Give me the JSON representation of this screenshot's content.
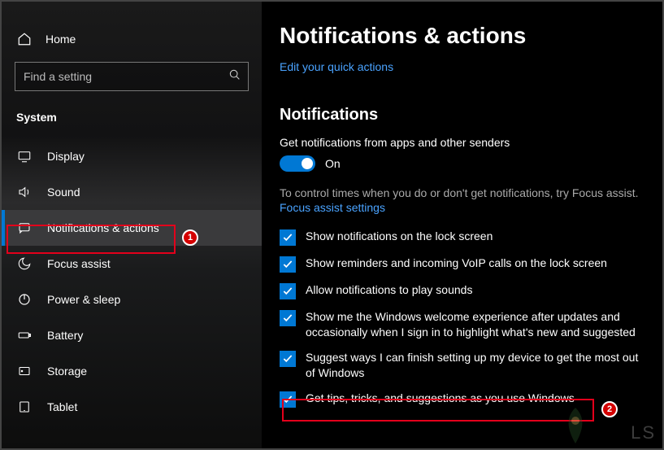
{
  "sidebar": {
    "home_label": "Home",
    "search_placeholder": "Find a setting",
    "section": "System",
    "items": [
      {
        "icon": "display",
        "label": "Display"
      },
      {
        "icon": "sound",
        "label": "Sound"
      },
      {
        "icon": "notifications",
        "label": "Notifications & actions",
        "active": true
      },
      {
        "icon": "focus",
        "label": "Focus assist"
      },
      {
        "icon": "power",
        "label": "Power & sleep"
      },
      {
        "icon": "battery",
        "label": "Battery"
      },
      {
        "icon": "storage",
        "label": "Storage"
      },
      {
        "icon": "tablet",
        "label": "Tablet"
      }
    ]
  },
  "main": {
    "title": "Notifications & actions",
    "quick_actions_link": "Edit your quick actions",
    "notifications_heading": "Notifications",
    "notif_desc": "Get notifications from apps and other senders",
    "toggle_state": "On",
    "hint": "To control times when you do or don't get notifications, try Focus assist.",
    "focus_link": "Focus assist settings",
    "checkboxes": [
      {
        "label": "Show notifications on the lock screen",
        "checked": true
      },
      {
        "label": "Show reminders and incoming VoIP calls on the lock screen",
        "checked": true
      },
      {
        "label": "Allow notifications to play sounds",
        "checked": true
      },
      {
        "label": "Show me the Windows welcome experience after updates and occasionally when I sign in to highlight what's new and suggested",
        "checked": true
      },
      {
        "label": "Suggest ways I can finish setting up my device to get the most out of Windows",
        "checked": true
      },
      {
        "label": "Get tips, tricks, and suggestions as you use Windows",
        "checked": true
      }
    ]
  },
  "annotations": {
    "badge1": "1",
    "badge2": "2"
  },
  "watermark": "LS"
}
